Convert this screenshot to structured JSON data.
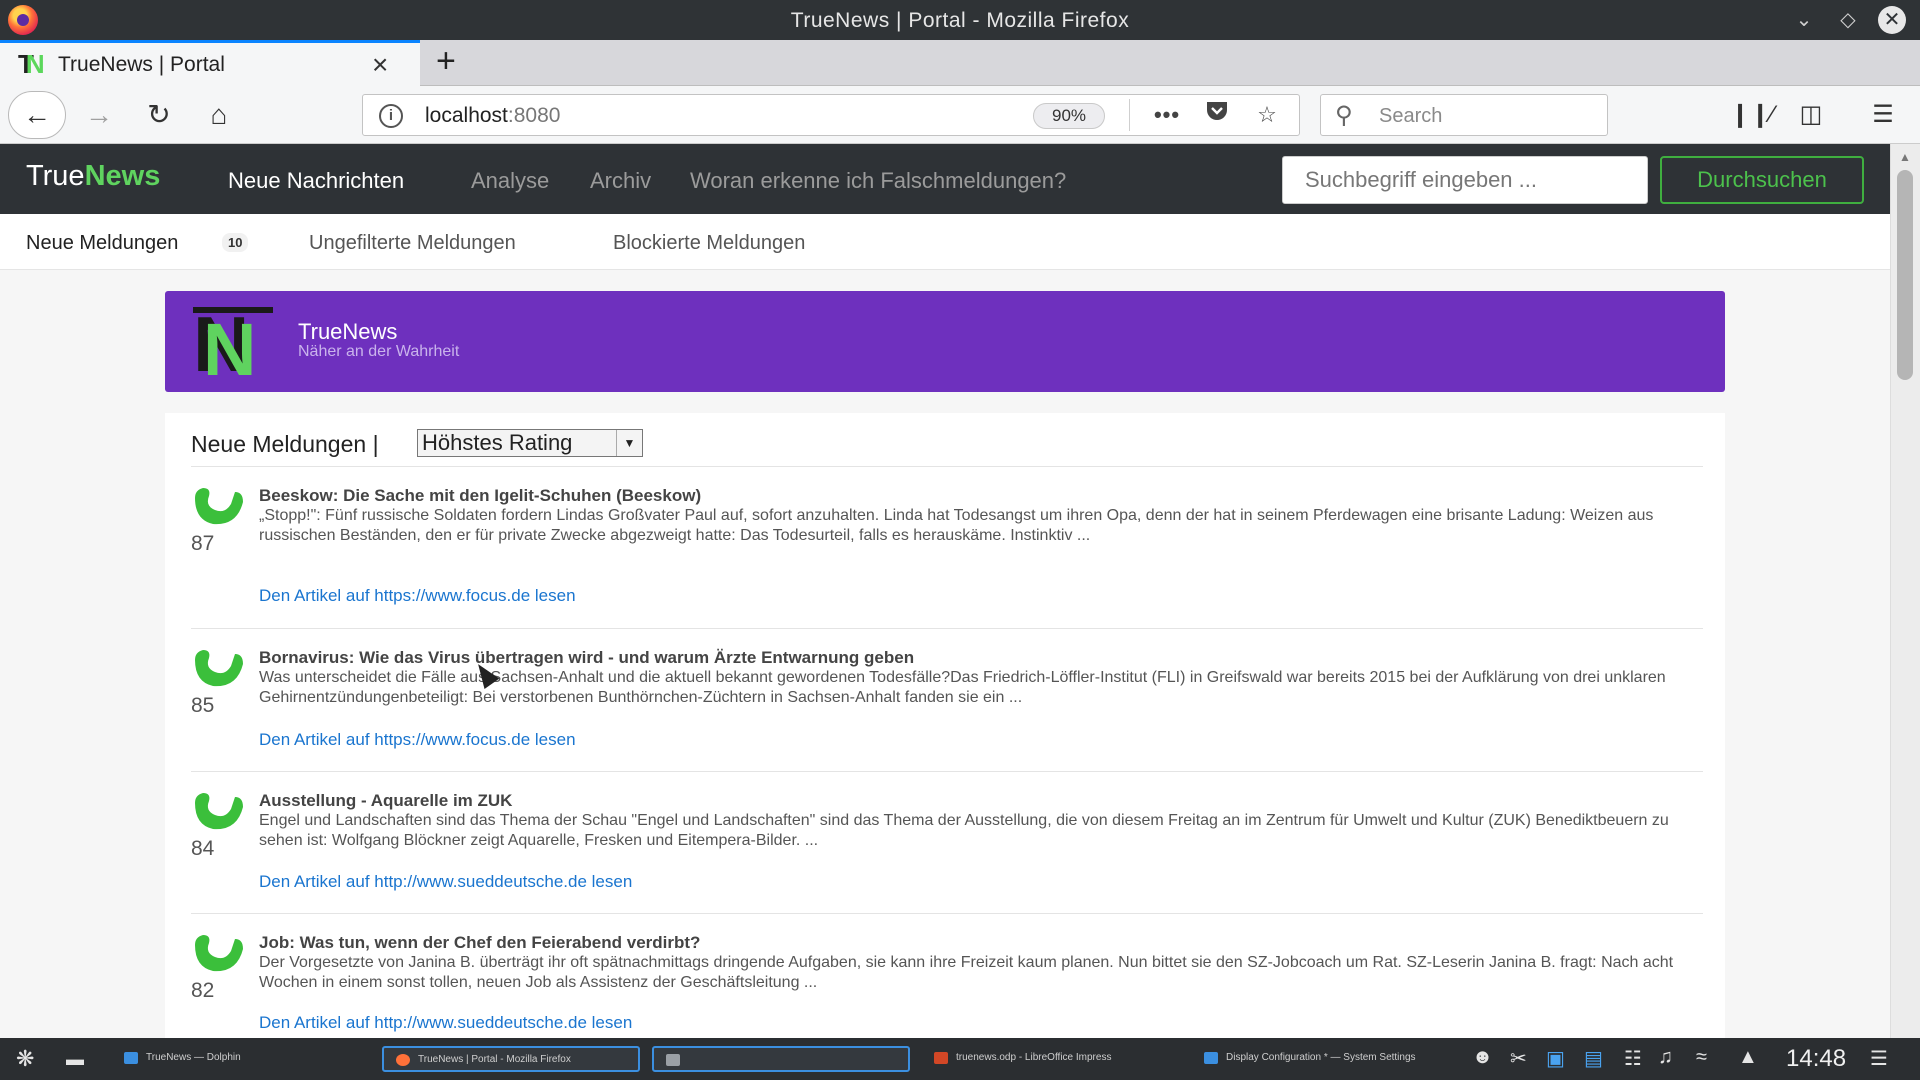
{
  "window": {
    "title": "TrueNews | Portal - Mozilla Firefox"
  },
  "browser": {
    "tab_title": "TrueNews | Portal",
    "url_host": "localhost",
    "url_port": ":8080",
    "zoom": "90%",
    "search_placeholder": "Search"
  },
  "site": {
    "brand_a": "True",
    "brand_b": "News",
    "nav": [
      "Neue Nachrichten",
      "Analyse",
      "Archiv",
      "Woran erkenne ich Falschmeldungen?"
    ],
    "search_placeholder": "Suchbegriff eingeben ...",
    "search_button": "Durchsuchen",
    "subnav": [
      "Neue Meldungen",
      "Ungefilterte Meldungen",
      "Blockierte Meldungen"
    ],
    "subnav_count": "10",
    "hero_title": "TrueNews",
    "hero_subtitle": "Näher an der Wahrheit",
    "hero_logo_letter": "N",
    "list_heading": "Neue Meldungen |",
    "sort_value": "Höhstes Rating",
    "accent_green": "#5fd35f",
    "accent_purple": "#6e30be"
  },
  "articles": [
    {
      "score": "87",
      "title": "Beeskow: Die Sache mit den Igelit-Schuhen (Beeskow)",
      "excerpt": "„Stopp!\": Fünf russische Soldaten fordern Lindas Großvater Paul auf, sofort anzuhalten. Linda hat Todesangst um ihren Opa, denn der hat in seinem Pferdewagen eine brisante Ladung: Weizen aus russischen Beständen, den er für private Zwecke abgezweigt hatte: Das Todesurteil, falls es herauskäme. Instinktiv ...",
      "link": "Den Artikel auf https://www.focus.de lesen"
    },
    {
      "score": "85",
      "title": "Bornavirus: Wie das Virus übertragen wird - und warum Ärzte Entwarnung geben",
      "excerpt": "Was unterscheidet die Fälle aus Sachsen-Anhalt und die aktuell bekannt gewordenen Todesfälle?Das Friedrich-Löffler-Institut (FLI) in Greifswald war bereits 2015 bei der Aufklärung von drei unklaren Gehirnentzündungenbeteiligt: Bei verstorbenen Bunthörnchen-Züchtern in Sachsen-Anhalt fanden sie ein ...",
      "link": "Den Artikel auf https://www.focus.de lesen"
    },
    {
      "score": "84",
      "title": "Ausstellung - Aquarelle im ZUK",
      "excerpt": "Engel und Landschaften sind das Thema der Schau \"Engel und Landschaften\" sind das Thema der Ausstellung, die von diesem Freitag an im Zentrum für Umwelt und Kultur (ZUK) Benediktbeuern zu sehen ist: Wolfgang Blöckner zeigt Aquarelle, Fresken und Eitempera-Bilder. ...",
      "link": "Den Artikel auf http://www.sueddeutsche.de lesen"
    },
    {
      "score": "82",
      "title": "Job: Was tun, wenn der Chef den Feierabend verdirbt?",
      "excerpt": "Der Vorgesetzte von Janina B. überträgt ihr oft spätnachmittags dringende Aufgaben, sie kann ihre Freizeit kaum planen. Nun bittet sie den SZ-Jobcoach um Rat. SZ-Leserin Janina B. fragt: Nach acht Wochen in einem sonst tollen, neuen Job als Assistenz der Geschäftsleitung ...",
      "link": "Den Artikel auf http://www.sueddeutsche.de lesen"
    }
  ],
  "taskbar": {
    "tasks": [
      "TrueNews — Dolphin",
      "TrueNews | Portal - Mozilla Firefox",
      "",
      "truenews.odp - LibreOffice Impress",
      "Display Configuration * — System Settings"
    ],
    "clock": "14:48"
  }
}
